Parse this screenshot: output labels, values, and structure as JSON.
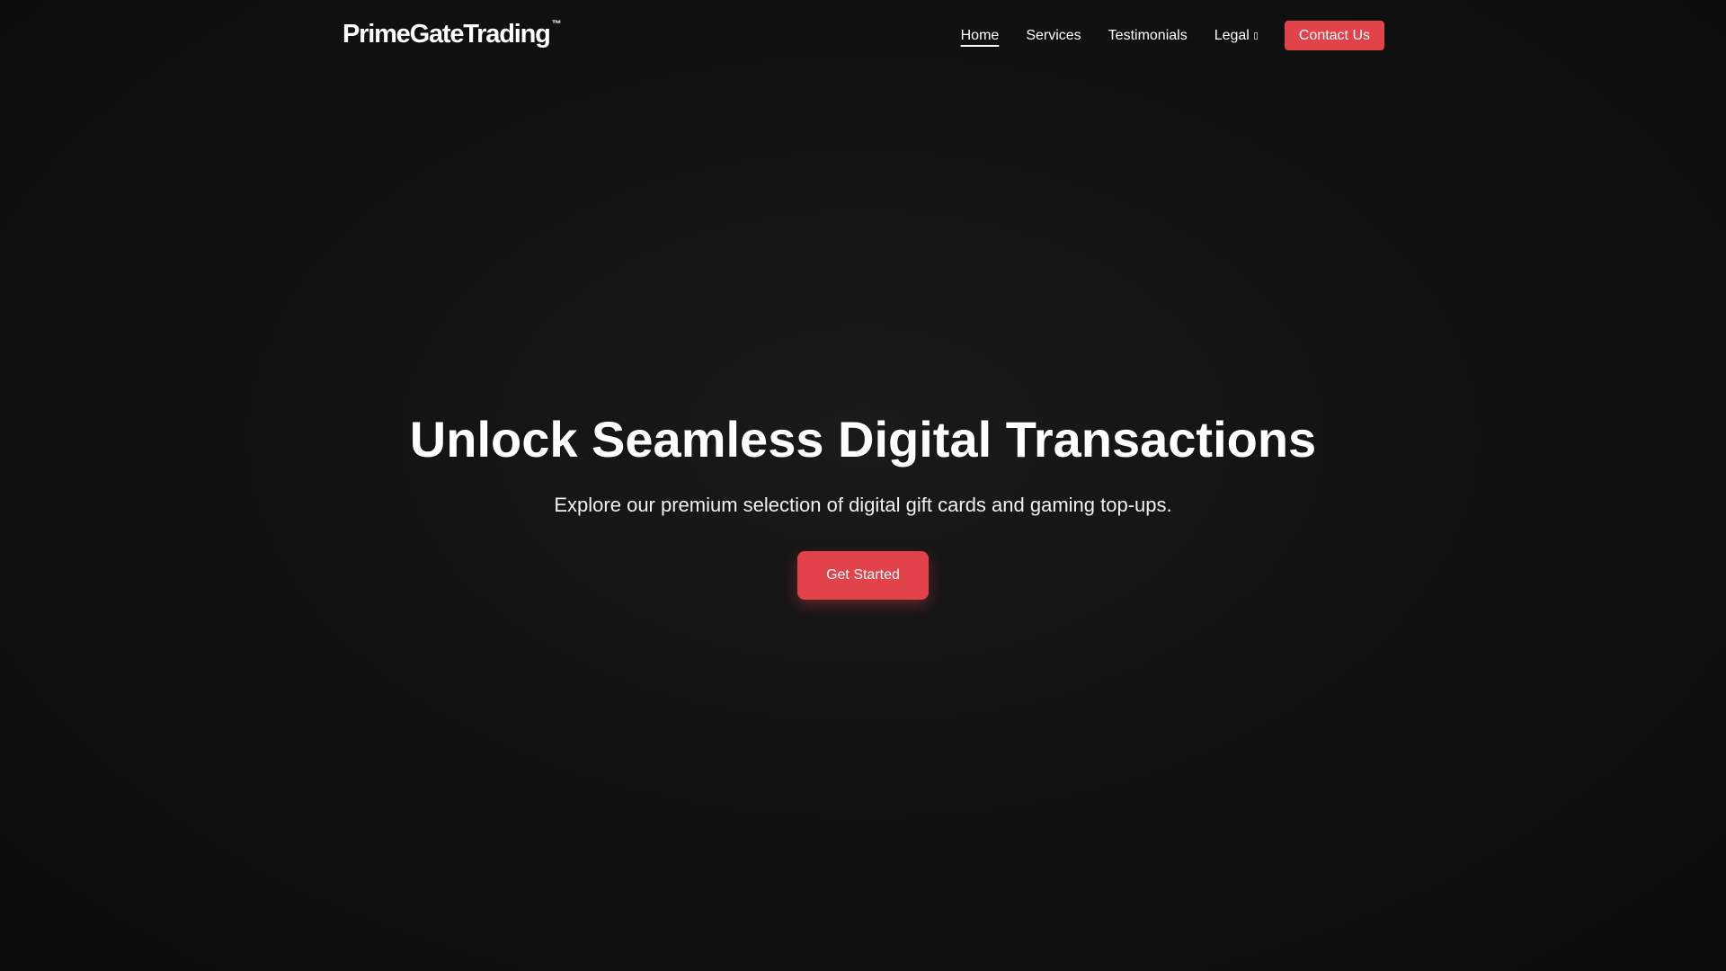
{
  "brand": {
    "name": "PrimeGateTrading",
    "trademark": "™"
  },
  "nav": {
    "items": [
      {
        "label": "Home",
        "active": true
      },
      {
        "label": "Services",
        "active": false
      },
      {
        "label": "Testimonials",
        "active": false
      },
      {
        "label": "Legal",
        "active": false,
        "icon": "chevron-down-icon"
      }
    ],
    "contact_label": "Contact Us"
  },
  "hero": {
    "title": "Unlock Seamless Digital Transactions",
    "subtitle": "Explore our premium selection of digital gift cards and gaming top-ups.",
    "cta_label": "Get Started"
  },
  "colors": {
    "background": "#0e0e0e",
    "accent": "#e2434a",
    "text": "#ffffff"
  }
}
